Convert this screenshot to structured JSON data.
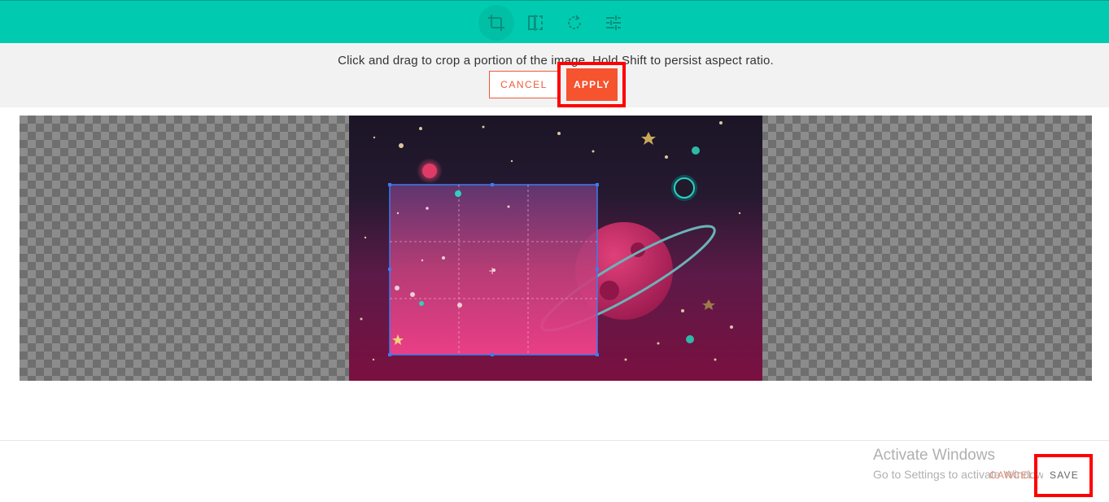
{
  "toolbar": {
    "background": "#00cbb0",
    "tools": [
      {
        "name": "crop-icon",
        "active": true
      },
      {
        "name": "flip-icon",
        "active": false
      },
      {
        "name": "rotate-icon",
        "active": false
      },
      {
        "name": "filters-icon",
        "active": false
      }
    ]
  },
  "crop_panel": {
    "instruction": "Click and drag to crop a portion of the image. Hold Shift to persist aspect ratio.",
    "cancel_label": "CANCEL",
    "apply_label": "APPLY",
    "accent": "#f6532f"
  },
  "footer": {
    "cancel_label": "CANCEL",
    "save_label": "SAVE"
  },
  "watermark": {
    "title": "Activate Windows",
    "subtitle": "Go to Settings to activate Windows."
  }
}
